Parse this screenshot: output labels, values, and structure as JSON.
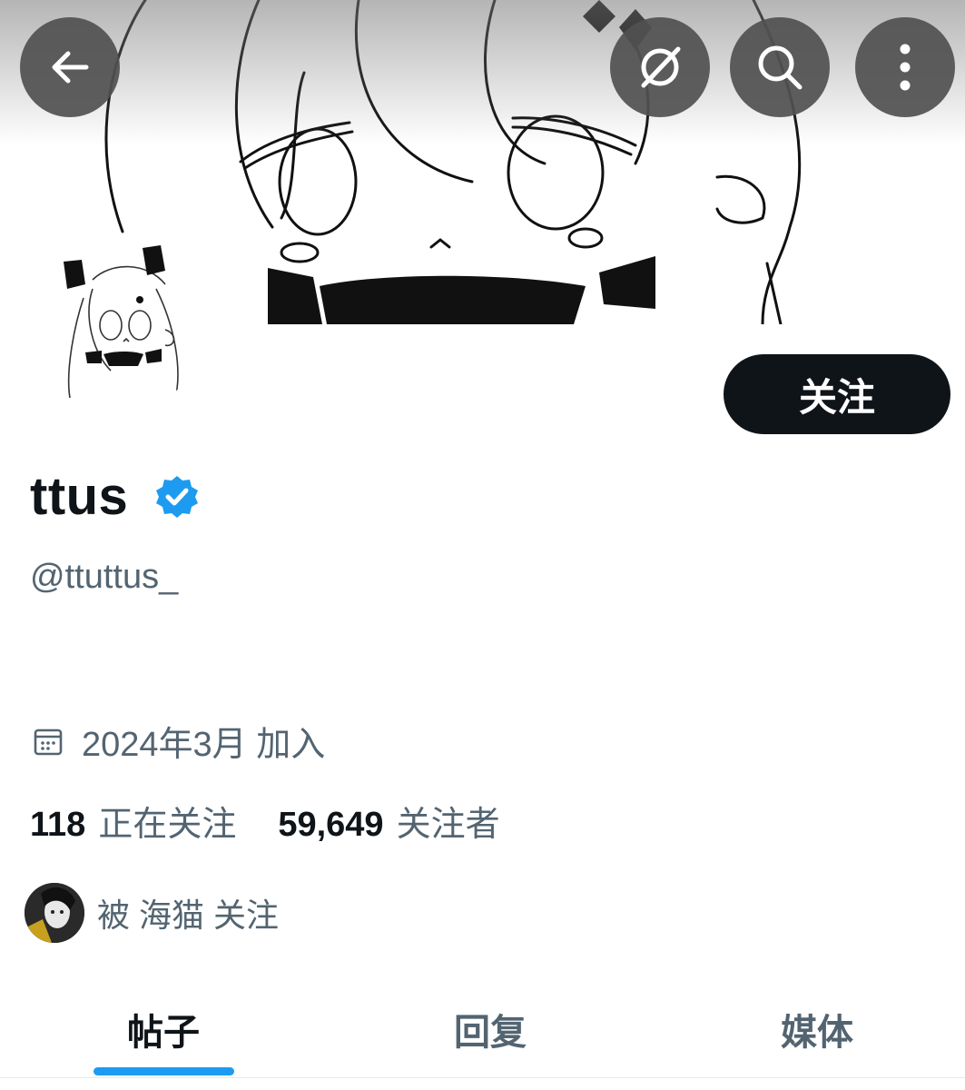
{
  "header": {
    "back_icon": "arrow-left-icon",
    "grok_icon": "grok-icon",
    "search_icon": "search-icon",
    "more_icon": "more-vertical-icon"
  },
  "profile": {
    "display_name": "ttus",
    "handle": "@ttuttus_",
    "verified": true,
    "follow_label": "关注",
    "joined": "2024年3月 加入",
    "following_count": "118",
    "following_label": "正在关注",
    "followers_count": "59,649",
    "followers_label": "关注者",
    "followed_by": "被 海猫 关注"
  },
  "tabs": [
    {
      "label": "帖子",
      "active": true
    },
    {
      "label": "回复",
      "active": false
    },
    {
      "label": "媒体",
      "active": false
    }
  ],
  "colors": {
    "accent": "#1d9bf0",
    "text_primary": "#0f1419",
    "text_secondary": "#536471"
  }
}
